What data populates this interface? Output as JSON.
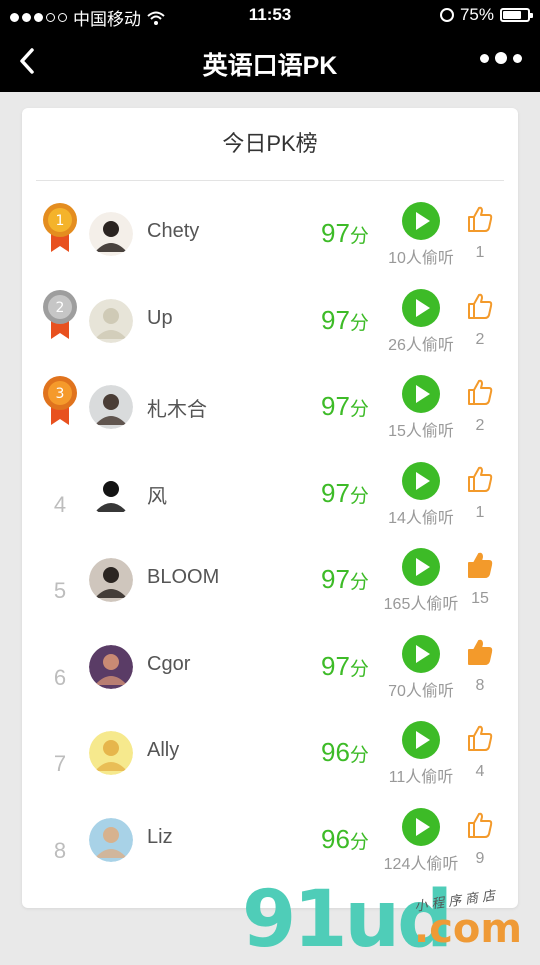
{
  "status": {
    "carrier": "中国移动",
    "time": "11:53",
    "battery": "75%",
    "battery_level": 0.75
  },
  "nav": {
    "title": "英语口语PK"
  },
  "board": {
    "title": "今日PK榜",
    "score_unit": "分"
  },
  "rows": [
    {
      "rank": "1",
      "name": "Chety",
      "score": "97",
      "listens": "10人偷听",
      "likes": "1",
      "liked": false,
      "medal": "gold",
      "avatar_colors": [
        "#f4efe9",
        "#2a2320"
      ]
    },
    {
      "rank": "2",
      "name": "Up",
      "score": "97",
      "listens": "26人偷听",
      "likes": "2",
      "liked": false,
      "medal": "silver",
      "avatar_colors": [
        "#e7e4d8",
        "#cfcab6"
      ]
    },
    {
      "rank": "3",
      "name": "札木合",
      "score": "97",
      "listens": "15人偷听",
      "likes": "2",
      "liked": false,
      "medal": "bronze",
      "avatar_colors": [
        "#d9dbdc",
        "#4a3d36"
      ]
    },
    {
      "rank": "4",
      "name": "风",
      "score": "97",
      "listens": "14人偷听",
      "likes": "1",
      "liked": false,
      "medal": "",
      "avatar_colors": [
        "#ffffff",
        "#141414"
      ]
    },
    {
      "rank": "5",
      "name": "BLOOM",
      "score": "97",
      "listens": "165人偷听",
      "likes": "15",
      "liked": true,
      "medal": "",
      "avatar_colors": [
        "#cfc6bd",
        "#2b2521"
      ]
    },
    {
      "rank": "6",
      "name": "Cgor",
      "score": "97",
      "listens": "70人偷听",
      "likes": "8",
      "liked": true,
      "medal": "",
      "avatar_colors": [
        "#5a3c66",
        "#c98a74"
      ]
    },
    {
      "rank": "7",
      "name": "Ally",
      "score": "96",
      "listens": "11人偷听",
      "likes": "4",
      "liked": false,
      "medal": "",
      "avatar_colors": [
        "#f6e98d",
        "#e6b64c"
      ]
    },
    {
      "rank": "8",
      "name": "Liz",
      "score": "96",
      "listens": "124人偷听",
      "likes": "9",
      "liked": false,
      "medal": "",
      "avatar_colors": [
        "#a8d2e7",
        "#d7b28e"
      ]
    }
  ],
  "colors": {
    "accent_green": "#3dbb27",
    "like_orange": "#f39a2b",
    "nav_bg": "#000000"
  },
  "icons": {
    "back": "chevron-left-icon",
    "more": "more-dots-icon",
    "play": "play-icon",
    "like": "thumbs-up-icon"
  },
  "watermark": {
    "main": "91ud",
    "suffix": ".com",
    "slogan": "小程序商店"
  }
}
